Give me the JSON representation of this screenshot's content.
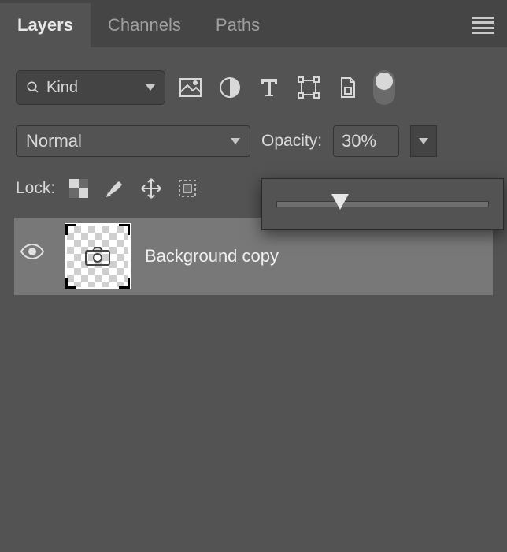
{
  "tabs": {
    "layers": "Layers",
    "channels": "Channels",
    "paths": "Paths"
  },
  "filter": {
    "kind": "Kind"
  },
  "blend": {
    "mode": "Normal",
    "opacity_label": "Opacity:",
    "opacity_value": "30%",
    "opacity_percent": 30
  },
  "lock": {
    "label": "Lock:"
  },
  "layers_list": [
    {
      "name": "Background copy"
    }
  ]
}
